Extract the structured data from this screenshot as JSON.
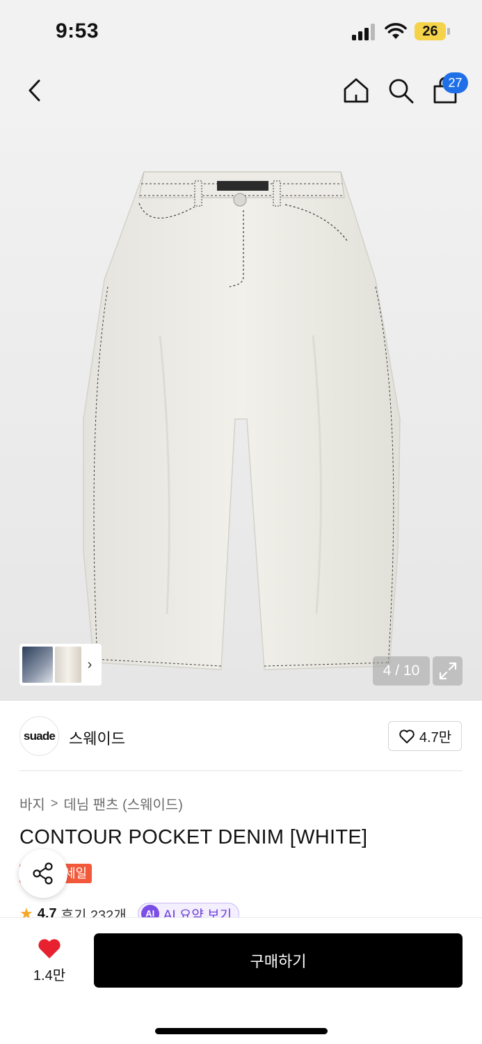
{
  "status_bar": {
    "time": "9:53",
    "battery": "26"
  },
  "nav": {
    "back_icon": "chevron-left-icon",
    "home_icon": "home-icon",
    "search_icon": "search-icon",
    "cart_icon": "shopping-bag-icon",
    "cart_count": "27"
  },
  "gallery": {
    "counter": "4 / 10",
    "expand_icon": "expand-icon",
    "thumb_arrow": "›"
  },
  "brand": {
    "logo_text": "suade",
    "name": "스웨이드",
    "likes": "4.7만"
  },
  "breadcrumb": {
    "category": "바지",
    "separator": ">",
    "subcategory": "데님 팬츠 (스웨이드)"
  },
  "product": {
    "title": "CONTOUR POCKET DENIM [WHITE]",
    "sale_badge": "세일"
  },
  "rating": {
    "score": "4.7",
    "reviews": "후기 232개",
    "ai_icon": "AI",
    "ai_label": "AI 요약 보기"
  },
  "bottom_bar": {
    "like_count": "1.4만",
    "buy_label": "구매하기"
  },
  "colors": {
    "accent": "#1f6fe8",
    "sale": "#f2593a",
    "heart": "#e8212e",
    "ai": "#7b4ee6",
    "battery": "#f4d34a"
  }
}
